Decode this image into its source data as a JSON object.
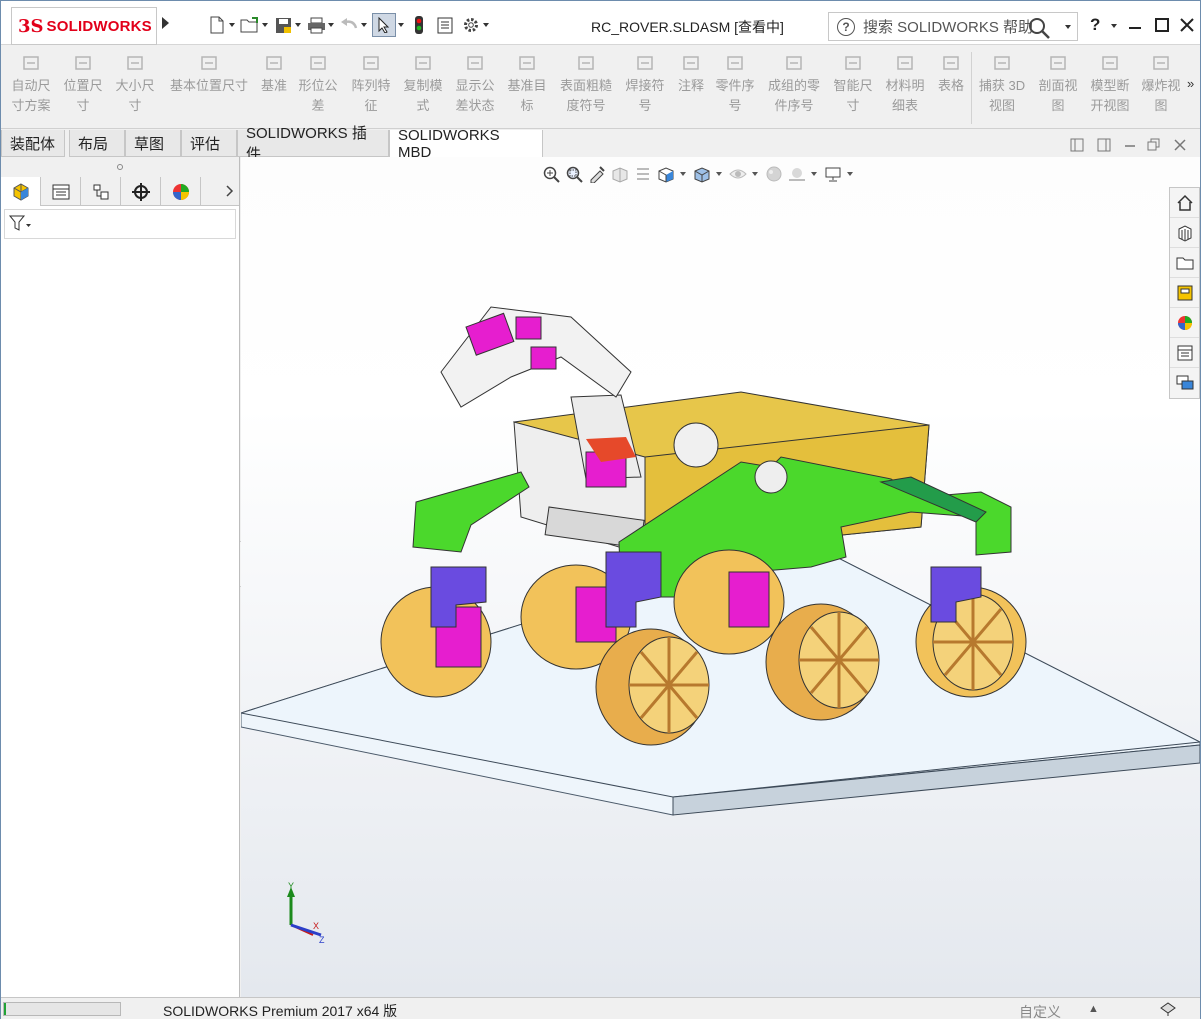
{
  "app": {
    "logo_prefix": "3S",
    "logo_text": "SOLIDWORKS",
    "document_title": "RC_ROVER.SLDASM [查看中]",
    "search_placeholder": "搜索 SOLIDWORKS 帮助",
    "help_label": "?"
  },
  "quick_access": [
    {
      "name": "new-document",
      "icon": "page-icon"
    },
    {
      "name": "open-document",
      "icon": "folder-open-icon"
    },
    {
      "name": "save-document",
      "icon": "save-icon"
    },
    {
      "name": "print",
      "icon": "printer-icon"
    },
    {
      "name": "undo",
      "icon": "undo-icon"
    },
    {
      "name": "select",
      "icon": "cursor-icon"
    },
    {
      "name": "rebuild",
      "icon": "traffic-light-icon"
    },
    {
      "name": "file-properties",
      "icon": "properties-icon"
    },
    {
      "name": "options",
      "icon": "gear-icon"
    }
  ],
  "ribbon": {
    "items": [
      {
        "line1": "自动尺",
        "line2": "寸方案"
      },
      {
        "line1": "位置尺",
        "line2": "寸"
      },
      {
        "line1": "大小尺",
        "line2": "寸"
      },
      {
        "line1": "基本位置尺寸",
        "line2": ""
      },
      {
        "line1": "基准",
        "line2": ""
      },
      {
        "line1": "形位公",
        "line2": "差"
      },
      {
        "line1": "阵列特",
        "line2": "征"
      },
      {
        "line1": "复制模",
        "line2": "式"
      },
      {
        "line1": "显示公",
        "line2": "差状态"
      },
      {
        "line1": "基准目",
        "line2": "标"
      },
      {
        "line1": "表面粗糙",
        "line2": "度符号"
      },
      {
        "line1": "焊接符",
        "line2": "号"
      },
      {
        "line1": "注释",
        "line2": ""
      },
      {
        "line1": "零件序",
        "line2": "号"
      },
      {
        "line1": "成组的零",
        "line2": "件序号"
      },
      {
        "line1": "智能尺",
        "line2": "寸"
      },
      {
        "line1": "材料明",
        "line2": "细表"
      },
      {
        "line1": "表格",
        "line2": ""
      },
      {
        "line1": "捕获 3D",
        "line2": "视图"
      },
      {
        "line1": "剖面视",
        "line2": "图"
      },
      {
        "line1": "模型断",
        "line2": "开视图"
      },
      {
        "line1": "爆炸视",
        "line2": "图"
      }
    ],
    "more_glyph": "»"
  },
  "tabs": [
    {
      "label": "装配体"
    },
    {
      "label": "布局"
    },
    {
      "label": "草图"
    },
    {
      "label": "评估"
    },
    {
      "label": "SOLIDWORKS 插件"
    },
    {
      "label": "SOLIDWORKS MBD"
    }
  ],
  "left_panel": {
    "tabs": [
      "feature-manager",
      "property-manager",
      "configuration-manager",
      "dimxpert-manager",
      "display-manager"
    ],
    "filter_icon": "filter-icon"
  },
  "heads_up_toolbar": [
    "zoom-to-fit",
    "zoom-to-area",
    "previous-view",
    "section-view",
    "dynamic-annotation",
    "view-orientation",
    "display-style",
    "hide-show-items",
    "edit-appearance",
    "apply-scene",
    "view-settings"
  ],
  "task_pane": [
    "home",
    "design-library",
    "file-explorer",
    "view-palette",
    "appearances",
    "custom-properties",
    "forum"
  ],
  "triad": {
    "x": "X",
    "y": "Y",
    "z": "Z"
  },
  "status": {
    "product": "SOLIDWORKS Premium 2017 x64 版",
    "custom": "自定义",
    "progress": 0.02,
    "caret": "▲"
  }
}
